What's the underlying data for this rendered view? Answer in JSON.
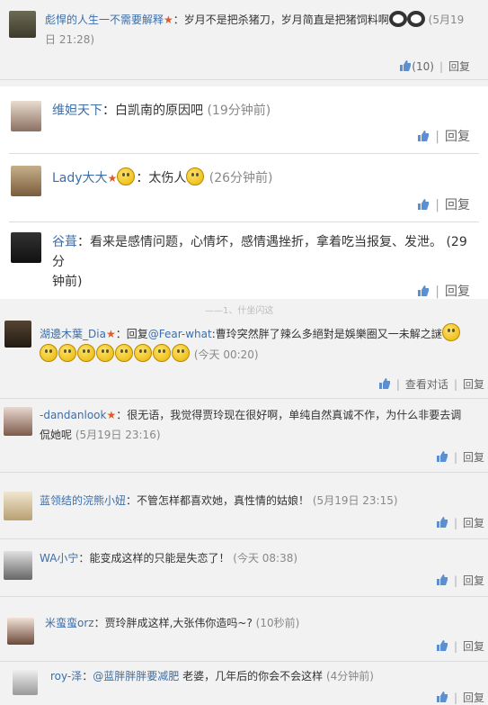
{
  "comments": [
    {
      "user": "彪悍的人生一不需要解释",
      "text": "岁月不是把杀猪刀，岁月简直是把猪饲料啊",
      "time_line1": "(5月19",
      "time_line2": "日 21:28)",
      "likes": "(10)",
      "reply": "回复"
    },
    {
      "user": "维妲天下",
      "text": "白凯南的原因吧",
      "time": "(19分钟前)",
      "reply": "回复"
    },
    {
      "user": "Lady大大",
      "text": "太伤人",
      "time": "(26分钟前)",
      "reply": "回复"
    },
    {
      "user": "谷葺",
      "text_line1": "看来是感情问题，心情坏，感情遇挫折，拿着吃当报复、发泄。 (29分",
      "text_line2": "钟前)",
      "reply": "回复"
    },
    {
      "user": "湖邊木葉_Dia",
      "reply_prefix": "回复",
      "mention": "@Fear-what",
      "text": "曹玲突然胖了辣么多絕對是娛樂圈又一未解之謎",
      "time": "(今天 00:20)",
      "view_conv": "查看对话",
      "reply": "回复"
    },
    {
      "user": "-dandanlook",
      "text_line1": "很无语，我觉得贾玲现在很好啊，单纯自然真诚不作，为什么非要去调",
      "text_line2": "侃她呢",
      "time": "(5月19日 23:16)",
      "reply": "回复"
    },
    {
      "user": "蓝领结的浣熊小妞",
      "text": "不管怎样都喜欢她，真性情的姑娘！",
      "time": "(5月19日 23:15)",
      "reply": "回复"
    },
    {
      "user": "WA小宁",
      "text": "能变成这样的只能是失恋了！",
      "time": "(今天 08:38)",
      "reply": "回复"
    },
    {
      "user": "米蛮蛮orz",
      "text": "贾玲胖成这样,大张伟你造吗~?",
      "time": "(10秒前)",
      "reply": "回复"
    },
    {
      "user": "roy-泽",
      "mention": "@蓝胖胖胖要减肥",
      "text": "老婆，几年后的你会不会这样",
      "time": "(4分钟前)",
      "reply": "回复"
    }
  ],
  "faded_text": "——1、什坐闪这",
  "colors": {
    "link": "#3d6ea8",
    "star": "#e05a2b",
    "bg": "#f2f2f2"
  }
}
